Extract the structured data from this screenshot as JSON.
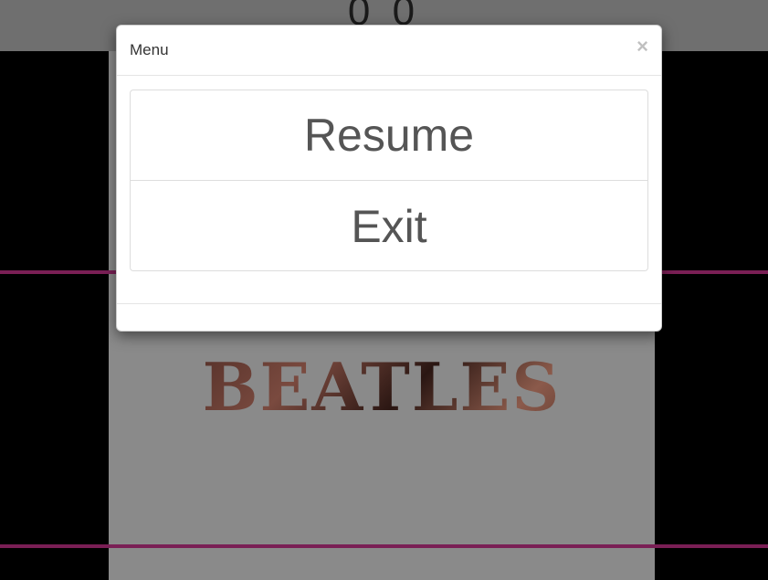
{
  "game": {
    "score": "0 0",
    "album_text": "BEATLES"
  },
  "modal": {
    "title": "Menu",
    "close_symbol": "×",
    "items": [
      {
        "label": "Resume"
      },
      {
        "label": "Exit"
      }
    ]
  },
  "colors": {
    "lane_line": "#7a1f55",
    "topbar": "#6f6f6f",
    "panel": "#8a8a8a"
  }
}
